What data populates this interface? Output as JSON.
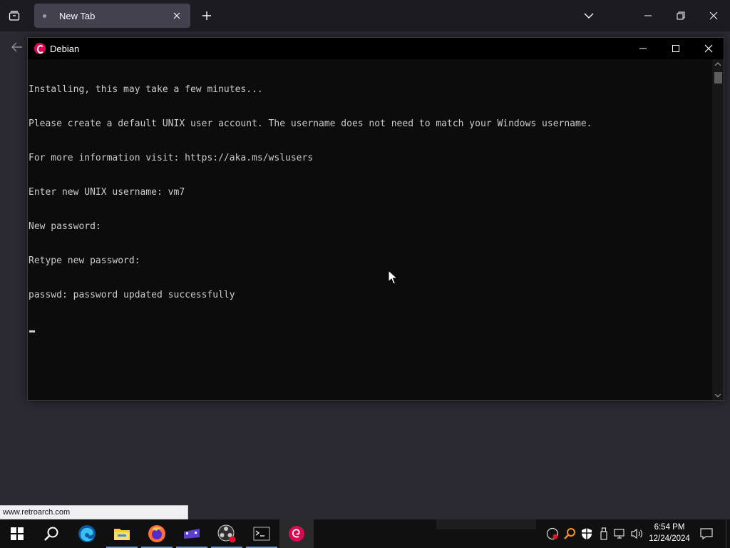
{
  "browser": {
    "tab_title": "New Tab",
    "status_url": "www.retroarch.com"
  },
  "console": {
    "title": "Debian",
    "lines": [
      "Installing, this may take a few minutes...",
      "Please create a default UNIX user account. The username does not need to match your Windows username.",
      "For more information visit: https://aka.ms/wslusers",
      "Enter new UNIX username: vm7",
      "New password:",
      "Retype new password:",
      "passwd: password updated successfully"
    ]
  },
  "taskbar": {
    "items": [
      "start-icon",
      "search-icon",
      "edge-icon",
      "file-explorer-icon",
      "firefox-icon",
      "retroarch-icon",
      "obs-icon",
      "terminal-icon",
      "debian-icon"
    ],
    "tray_icons": [
      "obs-tray-icon",
      "search-tray-icon",
      "defender-icon",
      "usb-icon",
      "network-icon",
      "volume-icon"
    ],
    "time": "6:54 PM",
    "date": "12/24/2024"
  },
  "colors": {
    "accent": "#d70a53",
    "taskbar_indicator": "#8ab4e8",
    "console_text": "#cccccc"
  }
}
